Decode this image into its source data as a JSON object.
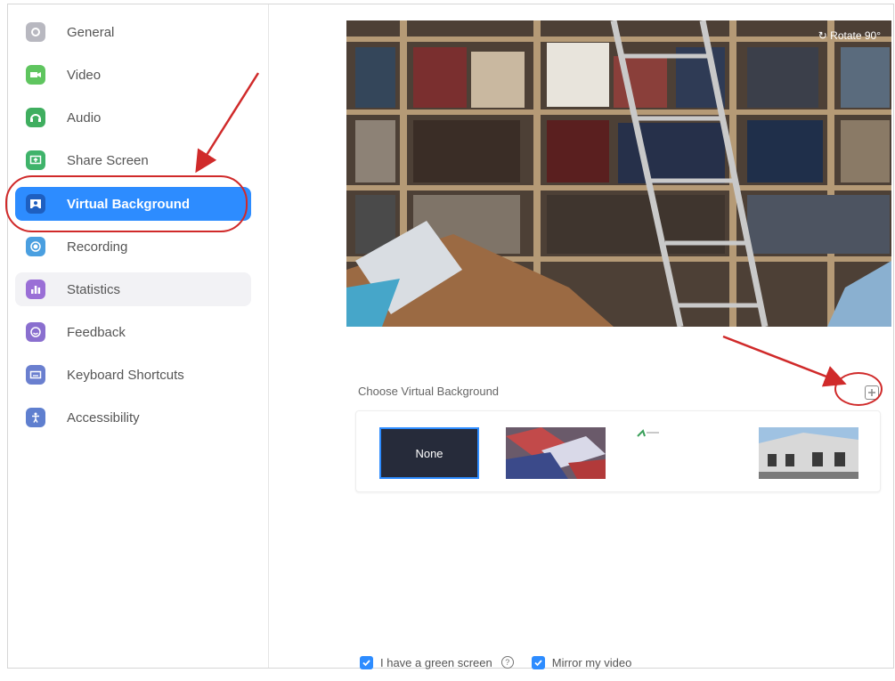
{
  "sidebar": {
    "items": [
      {
        "label": "General",
        "icon": "gear-icon",
        "color": "#b8b8c0",
        "active": false
      },
      {
        "label": "Video",
        "icon": "video-camera-icon",
        "color": "#5fc55f",
        "active": false
      },
      {
        "label": "Audio",
        "icon": "headphones-icon",
        "color": "#3fae5f",
        "active": false
      },
      {
        "label": "Share Screen",
        "icon": "share-screen-icon",
        "color": "#3fb36a",
        "active": false
      },
      {
        "label": "Virtual Background",
        "icon": "virtual-background-icon",
        "color": "#1e5fc0",
        "active": true
      },
      {
        "label": "Recording",
        "icon": "recording-icon",
        "color": "#4a9fe0",
        "active": false
      },
      {
        "label": "Statistics",
        "icon": "statistics-icon",
        "color": "#9a6fd6",
        "active": false
      },
      {
        "label": "Feedback",
        "icon": "feedback-icon",
        "color": "#8a6fcf",
        "active": false
      },
      {
        "label": "Keyboard Shortcuts",
        "icon": "keyboard-icon",
        "color": "#6a7fcf",
        "active": false
      },
      {
        "label": "Accessibility",
        "icon": "accessibility-icon",
        "color": "#5f7fcf",
        "active": false
      }
    ]
  },
  "preview": {
    "rotate_label": "Rotate 90°"
  },
  "backgrounds": {
    "title": "Choose Virtual Background",
    "none_label": "None",
    "thumbnails": [
      "none",
      "flags",
      "logo",
      "building"
    ]
  },
  "options": {
    "green_screen_label": "I have a green screen",
    "mirror_label": "Mirror my video",
    "green_screen_checked": true,
    "mirror_checked": true
  },
  "colors": {
    "accent": "#2d8cff",
    "annotation": "#d02a2a"
  }
}
